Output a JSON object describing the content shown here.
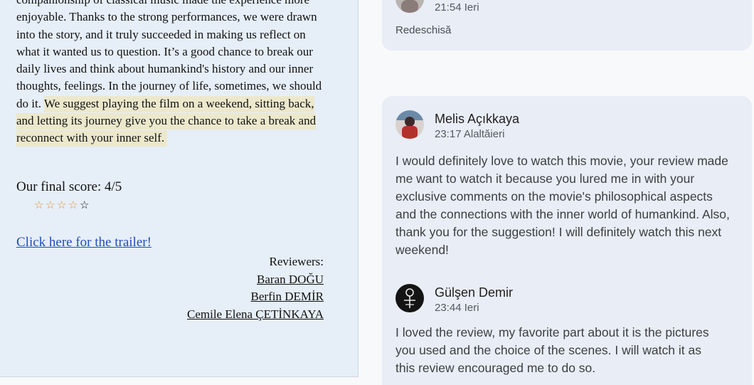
{
  "review": {
    "paragraph_plain": "companionship of classical music made the experience more enjoyable. Thanks to the strong performances, we were drawn into the story, and it truly succeeded in making us reflect on what it wanted us to question. It’s a good chance to break our daily lives and think about humankind's history and our inner thoughts, feelings. In the journey of life, sometimes, we should do it.",
    "paragraph_highlight": "We suggest playing the film on a weekend, sitting back, and letting its journey give you the chance to take a break and reconnect with your inner self.",
    "score_label": "Our final score: 4/5",
    "stars": {
      "filled": 4,
      "total": 5,
      "filled_glyph": "☆",
      "empty_glyph": "☆"
    },
    "trailer_link": "Click here for the trailer!",
    "reviewers_label": "Reviewers:",
    "reviewers": [
      "Baran DOĞU",
      "Berfin DEMİR",
      "Cemile Elena ÇETİNKAYA"
    ]
  },
  "comments_panel": {
    "top_card": {
      "time": "21:54 Ieri",
      "status": "Redeschisă"
    },
    "comments": [
      {
        "author": "Melis Açıkkaya",
        "time": "23:17 Alaltăieri",
        "text": "I would definitely love to watch this movie, your review made me want to watch it because you lured me in with your exclusive comments on the movie's philosophical aspects and the connections with the inner world of humankind. Also, thank you for the suggestion! I will definitely watch this next weekend!"
      },
      {
        "author": "Gülşen Demir",
        "time": "23:44 Ieri",
        "text": "I loved the review, my favorite part about it is the pictures you used and the choice of the scenes. I will watch it as this review encouraged me to do so."
      }
    ]
  },
  "colors": {
    "doc_background": "#e6eef8",
    "highlight": "#ece8cc",
    "card_background": "#e9edf5",
    "star_filled": "#e69628",
    "link": "#1f4fb5"
  }
}
